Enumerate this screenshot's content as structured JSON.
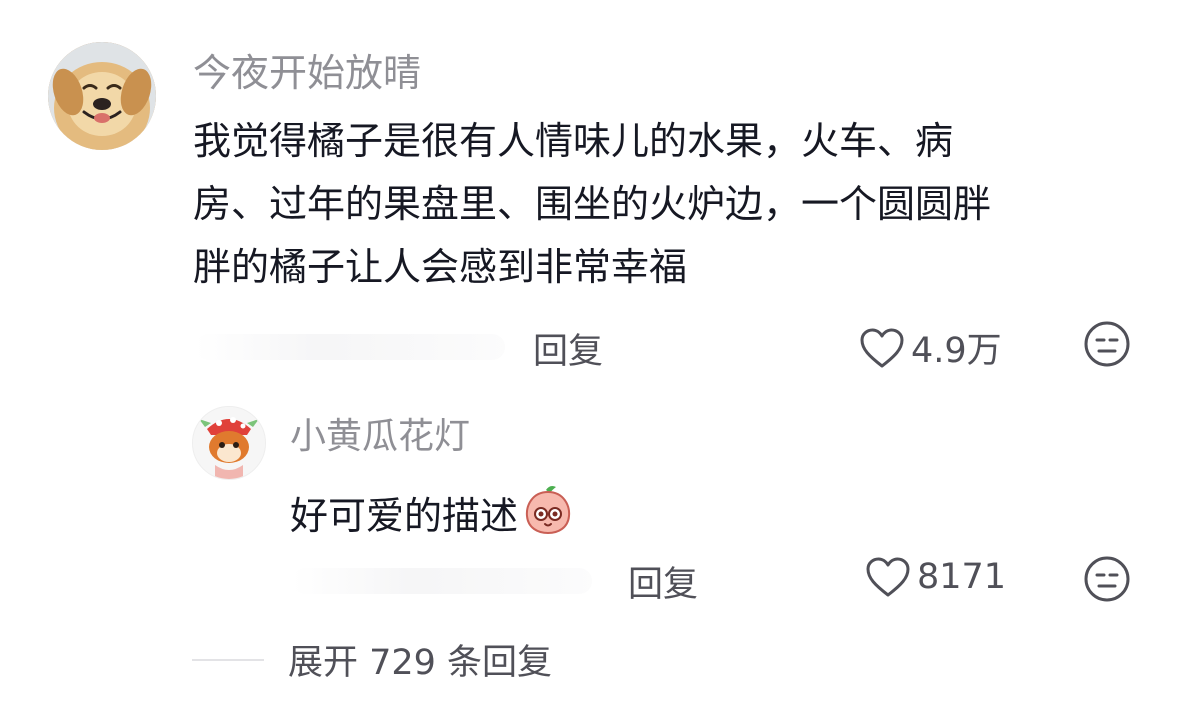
{
  "main_comment": {
    "username": "今夜开始放晴",
    "text_lines": [
      "我觉得橘子是很有人情味儿的水果，火车、病",
      "房、过年的果盘里、围坐的火炉边，一个圆圆胖",
      "胖的橘子让人会感到非常幸福"
    ],
    "reply_label": "回复",
    "like_count": "4.9万",
    "avatar_icon": "dog-avatar",
    "dislike_icon": "dislike-face-icon"
  },
  "sub_comment": {
    "username": "小黄瓜花灯",
    "text": "好可爱的描述",
    "emoji": "peach-face-emoji",
    "reply_label": "回复",
    "like_count": "8171",
    "avatar_icon": "fox-mushroom-avatar",
    "dislike_icon": "dislike-face-icon"
  },
  "expand": {
    "label": "展开 729 条回复"
  },
  "colors": {
    "text": "#161823",
    "username": "#8f8f95",
    "secondary": "#505058"
  }
}
